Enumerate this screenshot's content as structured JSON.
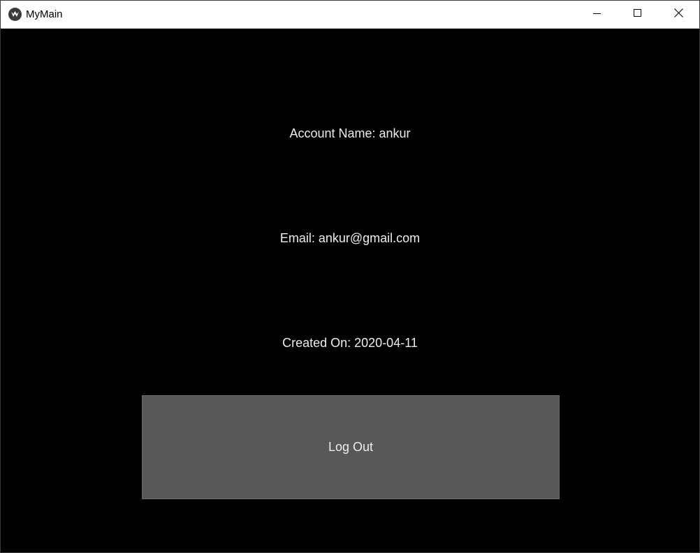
{
  "window": {
    "title": "MyMain",
    "controls": {
      "minimize_icon": "minimize-icon",
      "maximize_icon": "maximize-icon",
      "close_icon": "close-icon"
    }
  },
  "account": {
    "name_text": "Account Name: ankur",
    "email_text": "Email: ankur@gmail.com",
    "created_text": "Created On: 2020-04-11"
  },
  "actions": {
    "logout_label": "Log Out"
  },
  "colors": {
    "background": "#000000",
    "button": "#585858",
    "text": "#ededed"
  }
}
